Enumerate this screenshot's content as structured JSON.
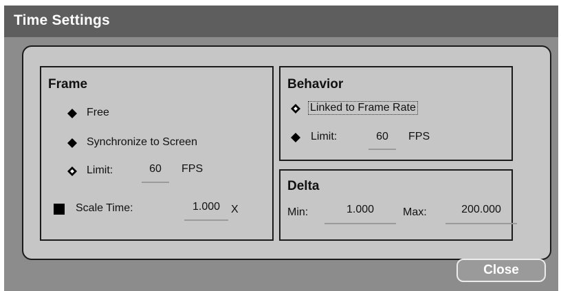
{
  "window": {
    "title": "Time Settings"
  },
  "frame": {
    "heading": "Frame",
    "free_label": "Free",
    "sync_label": "Synchronize to Screen",
    "limit_label": "Limit:",
    "limit_value": "60",
    "limit_unit": "FPS",
    "scale_label": "Scale Time:",
    "scale_value": "1.000",
    "scale_unit": "X",
    "selected": "limit",
    "scale_checked": true
  },
  "behavior": {
    "heading": "Behavior",
    "linked_label": "Linked to Frame Rate",
    "limit_label": "Limit:",
    "limit_value": "60",
    "limit_unit": "FPS",
    "selected": "linked"
  },
  "delta": {
    "heading": "Delta",
    "min_label": "Min:",
    "min_value": "1.000",
    "max_label": "Max:",
    "max_value": "200.000"
  },
  "buttons": {
    "close_label": "Close"
  },
  "icons": {
    "radio_selected": "hollow-diamond-radio-icon",
    "radio_unselected": "filled-diamond-radio-icon",
    "checkbox": "filled-square-checkbox-icon"
  },
  "colors": {
    "titlebar": "#5e5e5e",
    "window": "#8c8c8c",
    "panel": "#c6c6c6",
    "border": "#1a1a1a"
  }
}
